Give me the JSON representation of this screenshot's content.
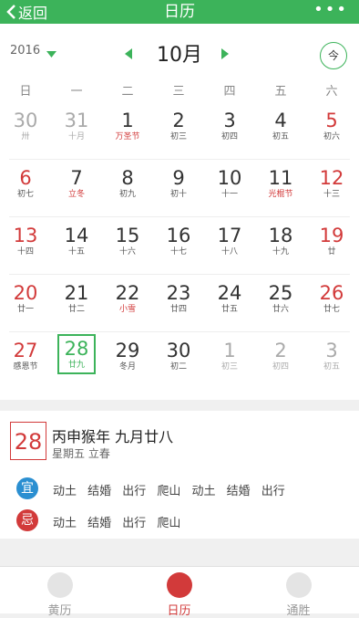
{
  "header": {
    "back_label": "返回",
    "title": "日历",
    "more_label": "•••"
  },
  "calendar": {
    "year": "2016",
    "month": "10月",
    "today_label": "今",
    "weekdays": [
      "日",
      "一",
      "二",
      "三",
      "四",
      "五",
      "六"
    ],
    "weeks": [
      [
        {
          "d": "30",
          "l": "卅",
          "m": 1
        },
        {
          "d": "31",
          "l": "十月",
          "m": 1
        },
        {
          "d": "1",
          "l": "万圣节",
          "f": 1
        },
        {
          "d": "2",
          "l": "初三"
        },
        {
          "d": "3",
          "l": "初四"
        },
        {
          "d": "4",
          "l": "初五"
        },
        {
          "d": "5",
          "l": "初六",
          "w": 1
        }
      ],
      [
        {
          "d": "6",
          "l": "初七",
          "w": 1
        },
        {
          "d": "7",
          "l": "立冬",
          "f": 1
        },
        {
          "d": "8",
          "l": "初九"
        },
        {
          "d": "9",
          "l": "初十"
        },
        {
          "d": "10",
          "l": "十一"
        },
        {
          "d": "11",
          "l": "光棍节",
          "f": 1
        },
        {
          "d": "12",
          "l": "十三",
          "w": 1
        }
      ],
      [
        {
          "d": "13",
          "l": "十四",
          "w": 1
        },
        {
          "d": "14",
          "l": "十五"
        },
        {
          "d": "15",
          "l": "十六"
        },
        {
          "d": "16",
          "l": "十七"
        },
        {
          "d": "17",
          "l": "十八"
        },
        {
          "d": "18",
          "l": "十九"
        },
        {
          "d": "19",
          "l": "廿",
          "w": 1
        }
      ],
      [
        {
          "d": "20",
          "l": "廿一",
          "w": 1
        },
        {
          "d": "21",
          "l": "廿二"
        },
        {
          "d": "22",
          "l": "小雪",
          "f": 1
        },
        {
          "d": "23",
          "l": "廿四"
        },
        {
          "d": "24",
          "l": "廿五"
        },
        {
          "d": "25",
          "l": "廿六"
        },
        {
          "d": "26",
          "l": "廿七",
          "w": 1
        }
      ],
      [
        {
          "d": "27",
          "l": "感恩节",
          "w": 1
        },
        {
          "d": "28",
          "l": "廿九",
          "s": 1
        },
        {
          "d": "29",
          "l": "冬月"
        },
        {
          "d": "30",
          "l": "初二"
        },
        {
          "d": "1",
          "l": "初三",
          "m": 1
        },
        {
          "d": "2",
          "l": "初四",
          "m": 1
        },
        {
          "d": "3",
          "l": "初五",
          "m": 1
        }
      ]
    ]
  },
  "detail": {
    "day": "28",
    "lunar": "丙申猴年 九月廿八",
    "weekday": "星期五 立春",
    "yi_label": "宜",
    "yi": "动土 结婚 出行 爬山 动土 结婚 出行",
    "ji_label": "忌",
    "ji": "动土 结婚 出行 爬山"
  },
  "tabs": [
    {
      "label": "黄历",
      "icon": "yin-yang-icon"
    },
    {
      "label": "日历",
      "icon": "calendar-icon",
      "active": true
    },
    {
      "label": "通胜",
      "icon": "yin-yang-icon"
    }
  ],
  "colors": {
    "green": "#3cb35a",
    "red": "#d23a3a",
    "blue": "#2b8fd1"
  }
}
